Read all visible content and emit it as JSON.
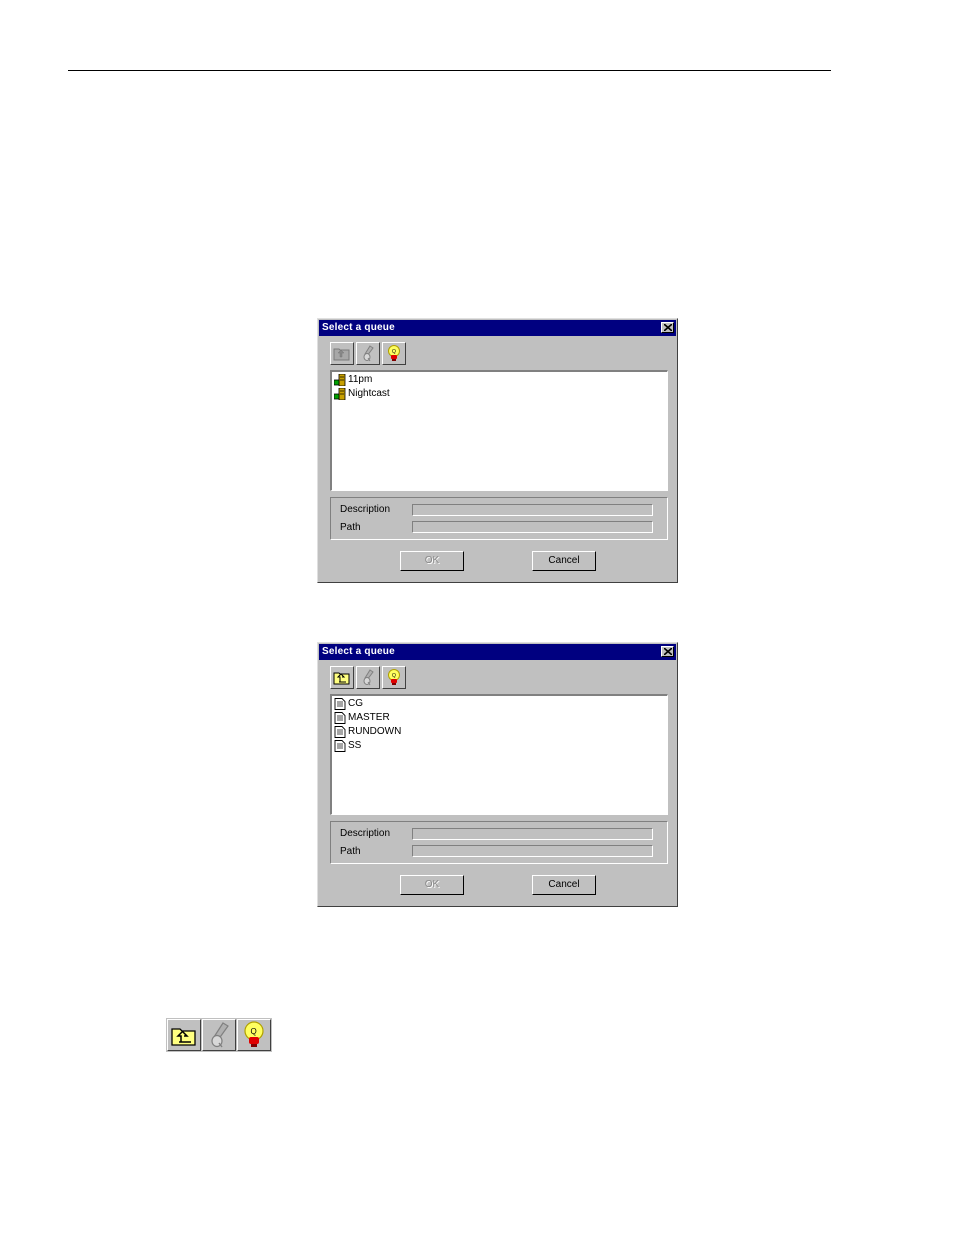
{
  "dialog1": {
    "title": "Select a queue",
    "items": [
      {
        "label": "11pm",
        "icon": "server-icon"
      },
      {
        "label": "Nightcast",
        "icon": "server-icon"
      }
    ],
    "description_label": "Description",
    "path_label": "Path",
    "description_value": "",
    "path_value": "",
    "ok_label": "OK",
    "cancel_label": "Cancel"
  },
  "dialog2": {
    "title": "Select a queue",
    "items": [
      {
        "label": "CG",
        "icon": "document-icon"
      },
      {
        "label": "MASTER",
        "icon": "document-icon"
      },
      {
        "label": "RUNDOWN",
        "icon": "document-icon"
      },
      {
        "label": "SS",
        "icon": "document-icon"
      }
    ],
    "description_label": "Description",
    "path_label": "Path",
    "description_value": "",
    "path_value": "",
    "ok_label": "OK",
    "cancel_label": "Cancel"
  },
  "toolbar_icons": [
    "folder-up-icon",
    "queue-tool-icon",
    "lightbulb-icon"
  ],
  "colors": {
    "titlebar": "#000080",
    "face": "#c0c0c0",
    "window": "#ffffff",
    "bulb": "#ffff60",
    "bulb_base": "#e00000"
  }
}
